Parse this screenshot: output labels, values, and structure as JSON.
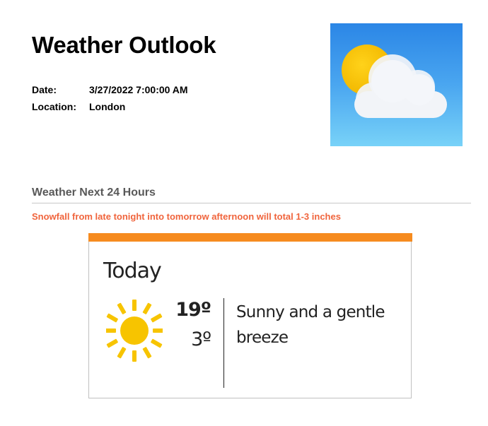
{
  "document": {
    "title": "Weather Outlook",
    "date_label": "Date:",
    "date_value": "3/27/2022 7:00:00 AM",
    "location_label": "Location:",
    "location_value": "London",
    "hero_icon": "sun-behind-cloud-icon"
  },
  "section": {
    "heading": "Weather Next 24 Hours",
    "alert": "Snowfall from late tonight into tomorrow afternoon will total 1-3 inches"
  },
  "forecast": {
    "day": "Today",
    "high": "19º",
    "low": "3º",
    "description": "Sunny and a gentle breeze",
    "icon": "sun-icon"
  },
  "colors": {
    "accent_orange": "#f68b1f",
    "alert_text": "#f0643c",
    "heading_gray": "#595959",
    "sky_top": "#2b86e6",
    "sky_bottom": "#78d2f8",
    "sun_yellow": "#f7c400"
  }
}
